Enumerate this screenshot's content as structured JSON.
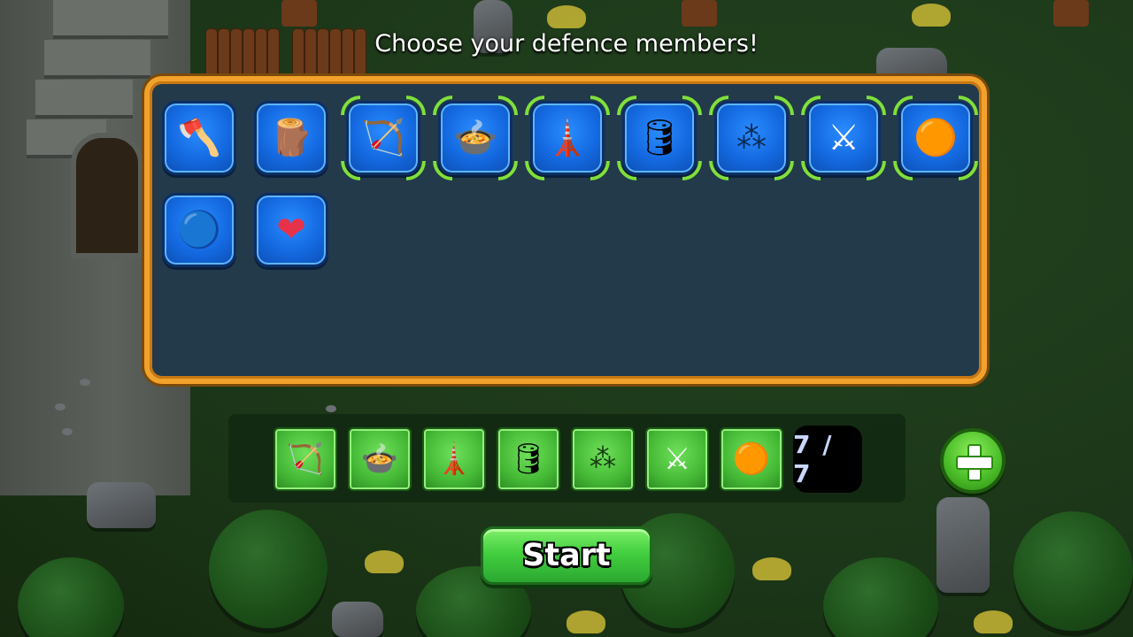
{
  "title": "Choose your defence members!",
  "roster": [
    {
      "name": "Axe warrior",
      "icon": "axe-warrior-icon",
      "glyph": "🪓",
      "selected": false
    },
    {
      "name": "Wooden wall",
      "icon": "wooden-wall-icon",
      "glyph": "🪵",
      "selected": false
    },
    {
      "name": "Archer",
      "icon": "archer-icon",
      "glyph": "🏹",
      "selected": true
    },
    {
      "name": "Chef",
      "icon": "chef-icon",
      "glyph": "🍲",
      "selected": true
    },
    {
      "name": "Stone tower",
      "icon": "stone-tower-icon",
      "glyph": "🗼",
      "selected": true
    },
    {
      "name": "Powder barrel",
      "icon": "barrel-bomb-icon",
      "glyph": "🛢",
      "selected": true
    },
    {
      "name": "Caltrops",
      "icon": "caltrops-icon",
      "glyph": "⁂",
      "selected": true
    },
    {
      "name": "Knight",
      "icon": "knight-icon",
      "glyph": "⚔",
      "selected": true
    },
    {
      "name": "Copper shield",
      "icon": "copper-shield-icon",
      "glyph": "🟠",
      "selected": true
    },
    {
      "name": "Blue shield",
      "icon": "blue-shield-icon",
      "glyph": "🔵",
      "selected": false
    },
    {
      "name": "Heart orb",
      "icon": "heart-orb-icon",
      "glyph": "❤",
      "selected": false
    }
  ],
  "team": [
    {
      "icon": "archer-icon",
      "glyph": "🏹"
    },
    {
      "icon": "chef-icon",
      "glyph": "🍲"
    },
    {
      "icon": "stone-tower-icon",
      "glyph": "🗼"
    },
    {
      "icon": "barrel-bomb-icon",
      "glyph": "🛢"
    },
    {
      "icon": "caltrops-icon",
      "glyph": "⁂"
    },
    {
      "icon": "knight-icon",
      "glyph": "⚔"
    },
    {
      "icon": "copper-shield-icon",
      "glyph": "🟠"
    }
  ],
  "team_count": "7 / 7",
  "start_label": "Start",
  "colors": {
    "panel_border": "#f2a22b",
    "panel_bg": "#233a4b",
    "slot_blue": "#1469e0",
    "slot_green": "#45b936",
    "selected_bracket": "#7fe03a"
  }
}
